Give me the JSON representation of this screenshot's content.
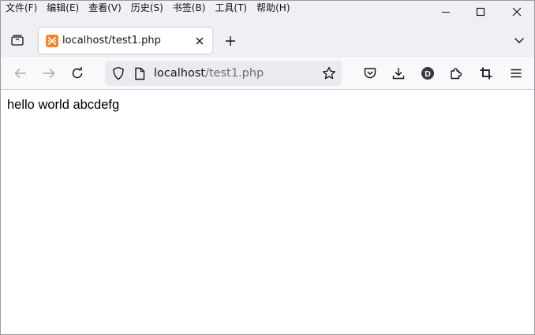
{
  "menu": [
    "文件(F)",
    "编辑(E)",
    "查看(V)",
    "历史(S)",
    "书签(B)",
    "工具(T)",
    "帮助(H)"
  ],
  "tab": {
    "title": "localhost/test1.php",
    "favicon": "xampp-icon",
    "favicon_color": "#f6822b"
  },
  "urlbar": {
    "host": "localhost",
    "path": "/test1.php"
  },
  "toolbar": {
    "account_initial": "D"
  },
  "page": {
    "text": "hello world abcdefg"
  },
  "colors": {
    "chrome": "#f0f0f4",
    "navbar": "#f9f9fb",
    "urlbar": "#ebebef",
    "disabled_icon": "#a9a9b0"
  }
}
